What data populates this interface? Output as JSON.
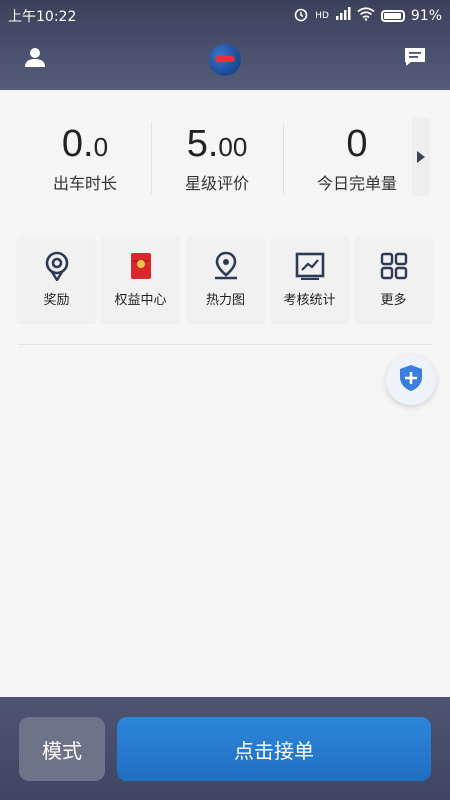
{
  "status_bar": {
    "time": "上午10:22",
    "network": "HD",
    "battery": "91%"
  },
  "header": {
    "left_icon": "person-icon",
    "logo": "app-logo",
    "right_icon": "message-icon"
  },
  "stats": [
    {
      "value_main": "0.",
      "value_small": "0",
      "label": "出车时长"
    },
    {
      "value_main": "5.",
      "value_small": "00",
      "label": "星级评价"
    },
    {
      "value_main": "0",
      "value_small": "",
      "label": "今日完单量"
    }
  ],
  "tiles": [
    {
      "label": "奖励",
      "icon": "award-icon"
    },
    {
      "label": "权益中心",
      "icon": "red-envelope-icon"
    },
    {
      "label": "热力图",
      "icon": "location-pin-icon"
    },
    {
      "label": "考核统计",
      "icon": "chart-icon"
    },
    {
      "label": "更多",
      "icon": "grid-icon"
    }
  ],
  "bottom": {
    "mode_label": "模式",
    "accept_label": "点击接单"
  },
  "colors": {
    "header_bg": "#3b4159",
    "accent": "#2e86d9",
    "icon_dark": "#2c3a55"
  }
}
